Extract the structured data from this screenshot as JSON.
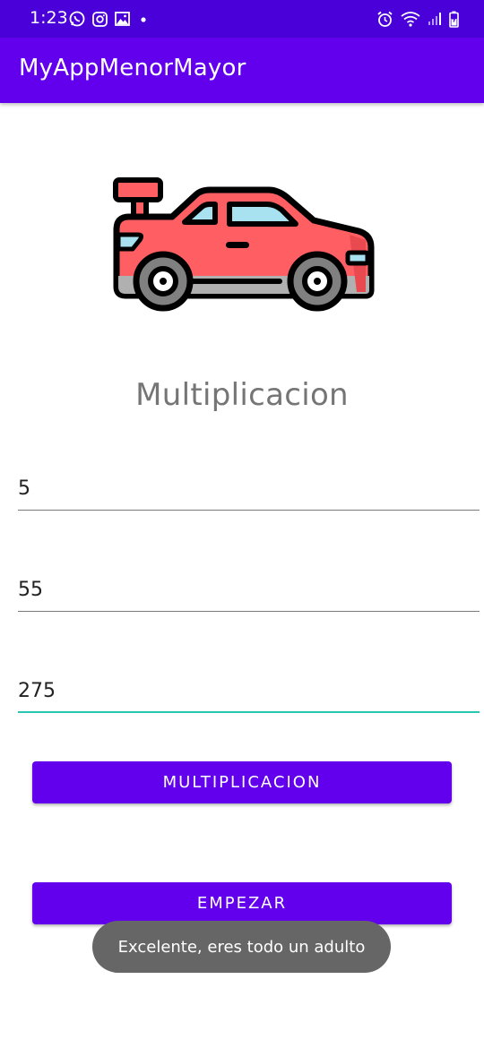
{
  "status_bar": {
    "time": "1:23",
    "left_icons": [
      "whatsapp-icon",
      "instagram-icon",
      "gallery-icon",
      "dot-icon"
    ],
    "right_icons": [
      "alarm-icon",
      "wifi-icon",
      "signal-icon",
      "battery-icon"
    ]
  },
  "app_bar": {
    "title": "MyAppMenorMayor",
    "color": "#6200ee"
  },
  "image": {
    "icon": "car-icon"
  },
  "heading": "Multiplicacion",
  "fields": [
    {
      "value": "5"
    },
    {
      "value": "55"
    },
    {
      "value": "275"
    }
  ],
  "buttons": {
    "multiply_label": "MULTIPLICACION",
    "start_label": "EMPEZAR"
  },
  "toast": "Excelente, eres todo un adulto",
  "colors": {
    "primary": "#6200ee",
    "status_bar": "#4a00d8",
    "accent": "#26c6b0"
  }
}
